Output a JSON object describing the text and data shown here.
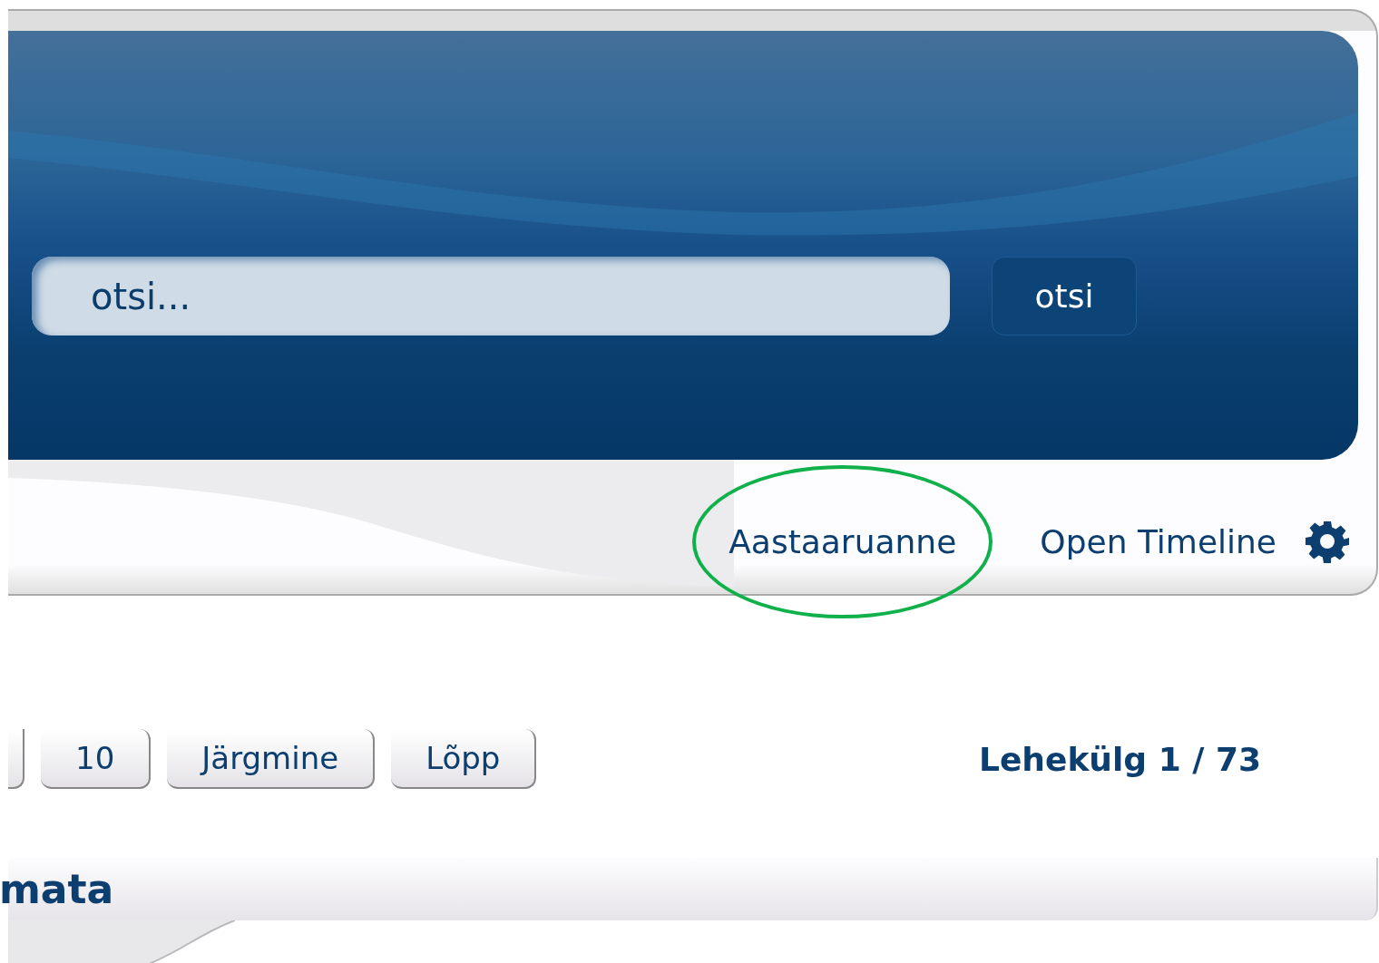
{
  "header": {
    "search": {
      "placeholder": "otsi..."
    },
    "search_button": "otsi",
    "links": [
      {
        "label": "Aastaaruanne",
        "highlighted": true
      },
      {
        "label": "Open Timeline",
        "highlighted": false
      }
    ]
  },
  "pagination": {
    "buttons": [
      "10",
      "Järgmine",
      "Lõpp"
    ],
    "page_info": "Lehekülg 1 / 73"
  },
  "section_title": "mata"
}
